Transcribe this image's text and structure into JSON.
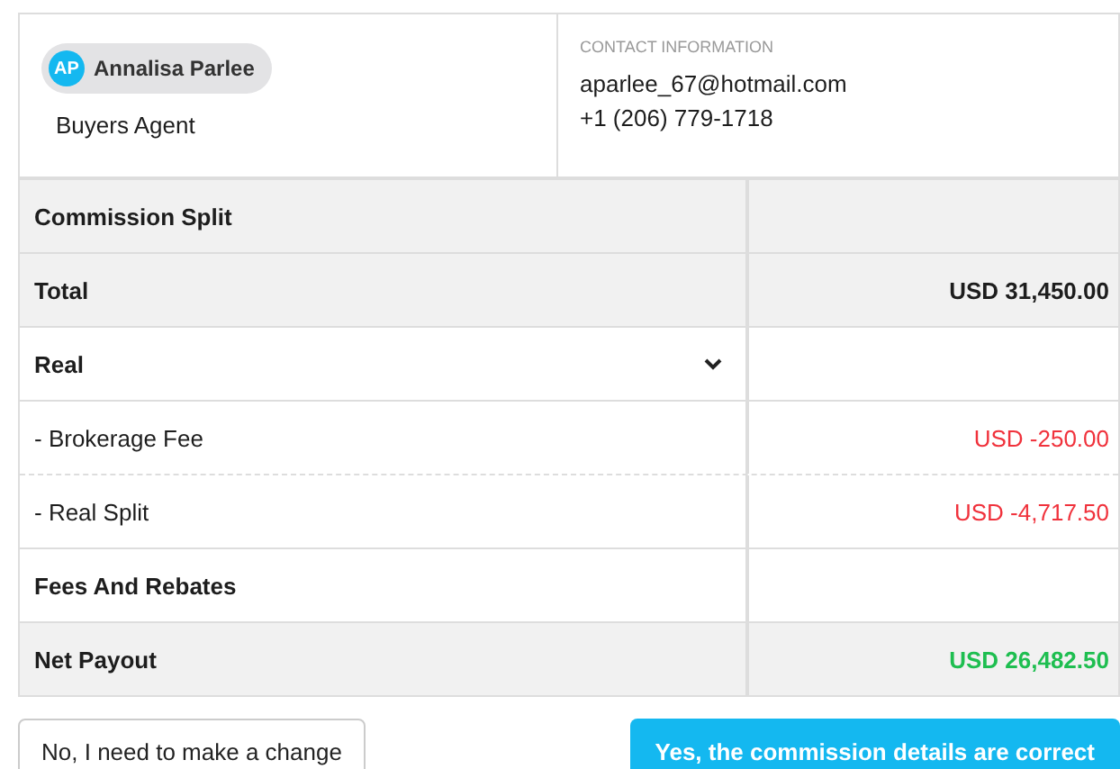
{
  "agent": {
    "initials": "AP",
    "name": "Annalisa Parlee",
    "role": "Buyers Agent"
  },
  "contact": {
    "heading": "CONTACT INFORMATION",
    "email": "aparlee_67@hotmail.com",
    "phone": "+1 (206) 779-1718"
  },
  "rows": [
    {
      "kind": "header",
      "label": "Commission Split"
    },
    {
      "kind": "total",
      "label": "Total",
      "amount": "USD 31,450.00"
    },
    {
      "kind": "group",
      "label": "Real",
      "expanded": true
    },
    {
      "kind": "deduction",
      "label": " - Brokerage Fee",
      "amount": "USD -250.00"
    },
    {
      "kind": "deduction",
      "label": " - Real Split",
      "amount": "USD -4,717.50"
    },
    {
      "kind": "section",
      "label": "Fees And Rebates"
    },
    {
      "kind": "net",
      "label": "Net Payout",
      "amount": "USD 26,482.50"
    }
  ],
  "buttons": {
    "reject": "No, I need to make a change",
    "confirm": "Yes, the commission details are correct"
  }
}
